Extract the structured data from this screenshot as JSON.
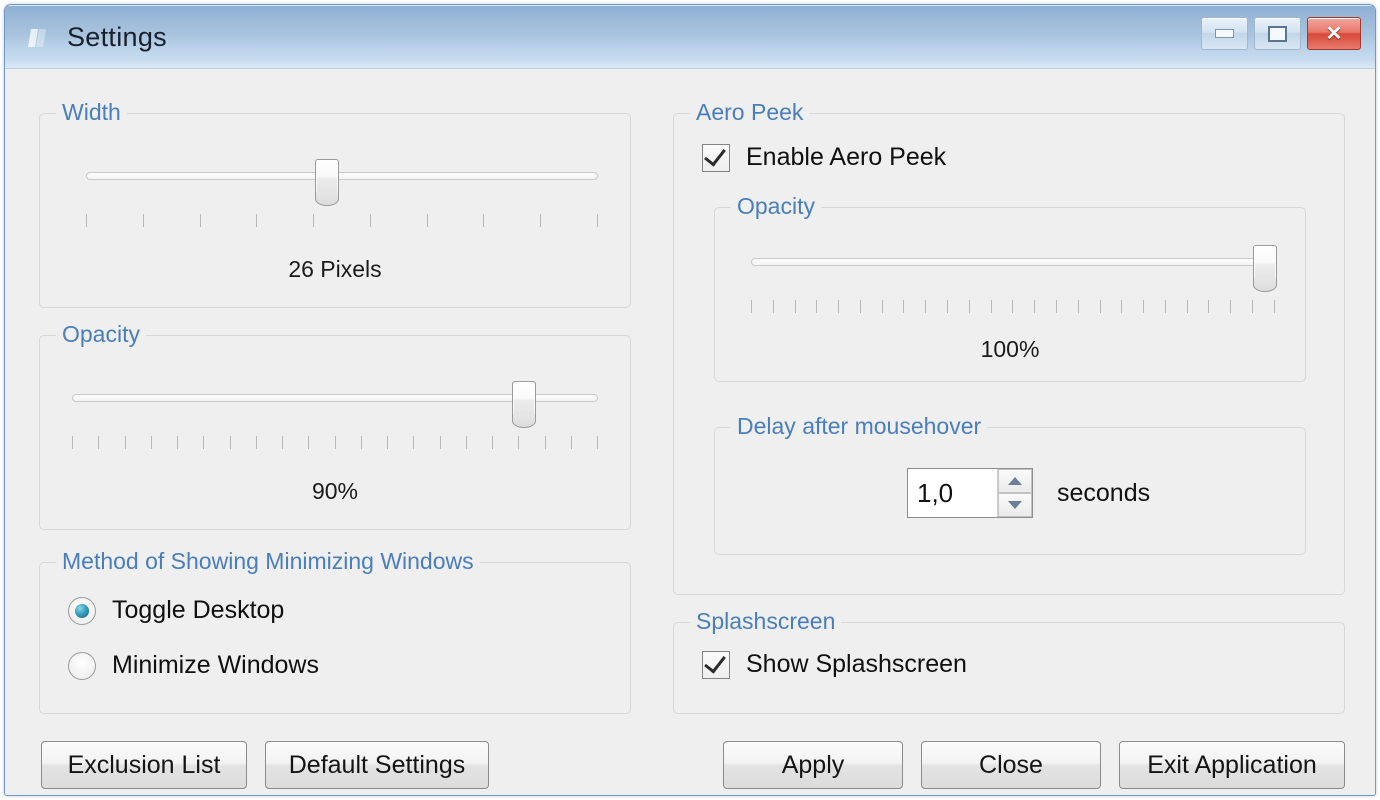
{
  "window": {
    "title": "Settings",
    "icon": "app-icon",
    "caption": {
      "minimize": "minimize-icon",
      "maximize": "maximize-icon",
      "close": "close-icon"
    }
  },
  "colors": {
    "group_title": "#4a7ebb",
    "titlebar_top": "#8fb0d3",
    "titlebar_bottom": "#dce9f6",
    "close_button": "#d8493a",
    "radio_dot": "#39a0bd",
    "client_background": "#efefef"
  },
  "left": {
    "width_group": {
      "title": "Width",
      "slider": {
        "value_label": "26 Pixels",
        "percent": 47,
        "ticks": 10
      }
    },
    "opacity_group": {
      "title": "Opacity",
      "slider": {
        "value_label": "90%",
        "percent": 86,
        "ticks": 21
      }
    },
    "minimize_method_group": {
      "title": "Method of Showing Minimizing Windows",
      "options": [
        {
          "label": "Toggle Desktop",
          "selected": true
        },
        {
          "label": "Minimize Windows",
          "selected": false
        }
      ]
    }
  },
  "right": {
    "aero_peek_group": {
      "title": "Aero Peek",
      "enable_checkbox": {
        "label": "Enable Aero Peek",
        "checked": true
      },
      "opacity_group": {
        "title": "Opacity",
        "slider": {
          "value_label": "100%",
          "percent": 98,
          "ticks": 25
        }
      },
      "delay_group": {
        "title": "Delay after mousehover",
        "spinner_value": "1,0",
        "suffix": "seconds"
      }
    },
    "splashscreen_group": {
      "title": "Splashscreen",
      "checkbox": {
        "label": "Show Splashscreen",
        "checked": true
      }
    }
  },
  "buttons": {
    "exclusion_list": "Exclusion List",
    "default_settings": "Default Settings",
    "apply": "Apply",
    "close": "Close",
    "exit_application": "Exit Application"
  }
}
